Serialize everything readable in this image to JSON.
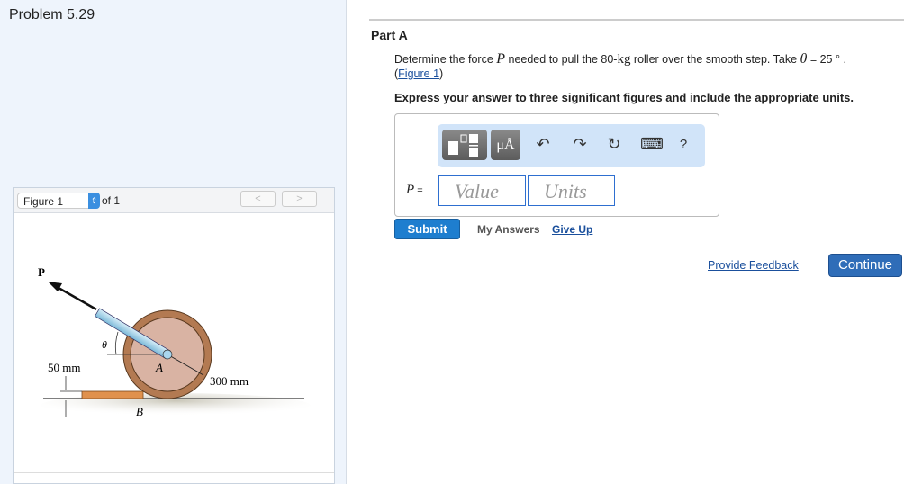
{
  "problem_title": "Problem 5.29",
  "figure_panel": {
    "selected": "Figure 1",
    "of_label": "of 1",
    "prev": "<",
    "next": ">"
  },
  "diagram": {
    "force_label": "P",
    "theta_label": "θ",
    "a_label": "A",
    "b_label": "B",
    "step_height": "50 mm",
    "radius": "300 mm"
  },
  "part": {
    "title": "Part A",
    "q_pre": "Determine the force ",
    "q_var": "P",
    "q_mid": " needed to pull the 80-",
    "q_unit": "kg",
    "q_mid2": " roller over the smooth step. Take ",
    "q_theta": "θ",
    "q_end": " = 25 ° .",
    "fig_link_open": "(",
    "fig_link": "Figure 1",
    "fig_link_close": ")",
    "instructions": "Express your answer to three significant figures and include the appropriate units."
  },
  "answer": {
    "toolbar": {
      "units_btn": "μÅ",
      "undo": "↶",
      "redo": "↷",
      "reset": "↻",
      "keyboard": "⌨",
      "help": "?"
    },
    "label": "P =",
    "value_placeholder": "Value",
    "units_placeholder": "Units"
  },
  "actions": {
    "submit": "Submit",
    "my_answers": "My Answers",
    "give_up": "Give Up",
    "feedback": "Provide Feedback",
    "continue": "Continue"
  }
}
